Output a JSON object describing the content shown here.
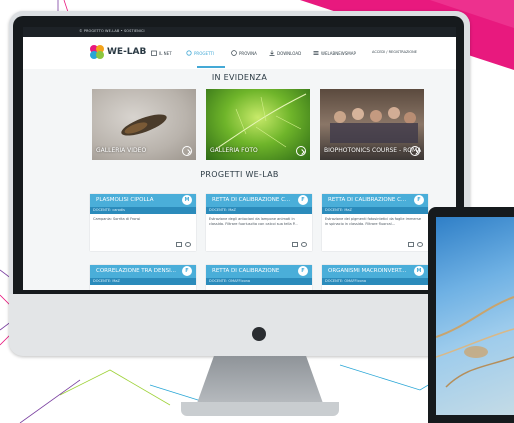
{
  "topbar": {
    "text": "© PROGETTO WE-LAB • SOSTIENICI",
    "flag_colors": [
      "#c0392b",
      "#ffffff",
      "#e67e22"
    ]
  },
  "logo": {
    "text": "WE-LAB",
    "icon": "puzzle-logo-icon"
  },
  "nav": {
    "items": [
      {
        "label": "IL NET",
        "icon": "building-icon",
        "active": false
      },
      {
        "label": "PROGETTI",
        "icon": "gear-icon",
        "active": true
      },
      {
        "label": "PROVINA",
        "icon": "smiley-icon",
        "active": false
      },
      {
        "label": "DOWNLOAD",
        "icon": "download-icon",
        "active": false
      },
      {
        "label": "WELABNEWSMAP",
        "icon": "menu-icon",
        "active": false
      }
    ],
    "login": "ACCEDI / REGISTRAZIONE"
  },
  "sections": {
    "featured_title": "IN EVIDENZA",
    "projects_title": "PROGETTI WE-LAB"
  },
  "featured": [
    {
      "label": "GALLERIA VIDEO"
    },
    {
      "label": "GALLERIA FOTO"
    },
    {
      "label": "BIOPHOTONICS COURSE - ROMA"
    }
  ],
  "projects": [
    {
      "title": "PLASMOLISI CIPOLLA",
      "sub": "DOCENTE: carodis",
      "desc": "Campania: Sorrita di Fronsi",
      "badge": "M"
    },
    {
      "title": "RETTA DI CALIBRAZIONE C...",
      "sub": "DOCENTE: MaZ",
      "desc": "Estrazione degli antociani da lampone animati in classida. Filtrare fuoriuscita con calcoi sua tella P...",
      "badge": "F"
    },
    {
      "title": "RETTA DI CALIBRAZIONE C...",
      "sub": "DOCENTE: MaZ",
      "desc": "Estrazione dei pigmenti fotosintetici da foglie immerse in spinacio in classida. Filtrare fluorcal...",
      "badge": "F"
    },
    {
      "title": "CORRELAZIONE TRA DENSI...",
      "sub": "DOCENTE: MaZ",
      "desc": "",
      "badge": "F"
    },
    {
      "title": "RETTA DI CALIBRAZIONE",
      "sub": "DOCENTE: OMAFFIcona",
      "desc": "",
      "badge": "F"
    },
    {
      "title": "ORGANISMI MACROINVERT...",
      "sub": "DOCENTE: OMAFFIcona",
      "desc": "",
      "badge": "M"
    }
  ],
  "colors": {
    "accent": "#44a9d6",
    "header_blue": "#4aaed9",
    "sub_blue": "#2b8bbb",
    "deco_pink": "#e8197e"
  }
}
